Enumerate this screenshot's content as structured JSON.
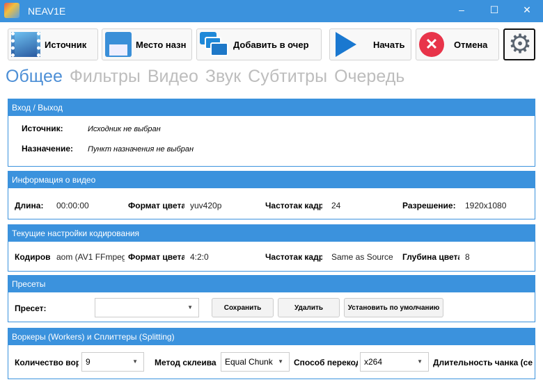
{
  "window": {
    "title": "NEAV1E",
    "minimize": "–",
    "maximize": "☐",
    "close": "✕"
  },
  "toolbar": {
    "source": "Источник",
    "destination": "Место назн",
    "add_queue": "Добавить в очер",
    "start": "Начать",
    "cancel": "Отмена"
  },
  "tabs": [
    "Общее",
    "Фильтры",
    "Видео",
    "Звук",
    "Субтитры",
    "Очередь"
  ],
  "io": {
    "title": "Вход / Выход",
    "source_label": "Источник:",
    "source_value": "Исходник не выбран",
    "dest_label": "Назначение:",
    "dest_value": "Пункт назначения не выбран"
  },
  "video_info": {
    "title": "Информация о видео",
    "length_label": "Длина:",
    "length": "00:00:00",
    "color_label": "Формат цвета",
    "color": "yuv420p",
    "fps_label": "Частотак кадр",
    "fps": "24",
    "res_label": "Разрешение:",
    "res": "1920x1080"
  },
  "encoding": {
    "title": "Текущие настройки кодирования",
    "encoder_label": "Кодиров",
    "encoder": "aom (AV1 FFmpeg",
    "color_label": "Формат цвета",
    "color": "4:2:0",
    "fps_label": "Частотак кадр",
    "fps": "Same as Source",
    "depth_label": "Глубина цвета",
    "depth": "8"
  },
  "presets": {
    "title": "Пресеты",
    "label": "Пресет:",
    "value": "",
    "save": "Сохранить",
    "delete": "Удалить",
    "default": "Установить по умолчанию"
  },
  "workers": {
    "title": "Воркеры (Workers) и Сплиттеры (Splitting)",
    "count_label": "Количество вор",
    "count": "9",
    "concat_label": "Метод склеива",
    "concat": "Equal Chunk",
    "split_label": "Способ перекод",
    "split": "x264",
    "chunk_label": "Длительность чанка (се"
  },
  "colors": {
    "accent": "#3b92dd"
  }
}
